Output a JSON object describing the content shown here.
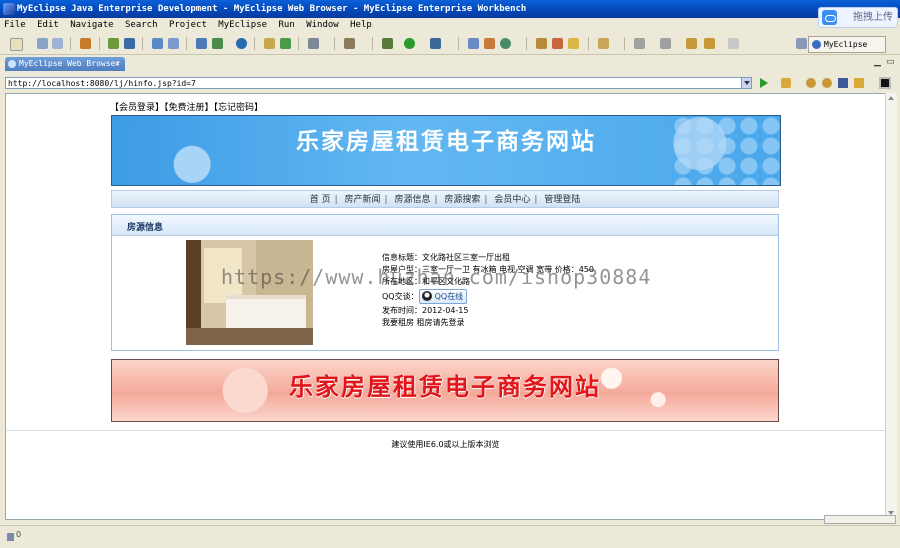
{
  "window": {
    "title": "MyEclipse Java Enterprise Development - MyEclipse Web Browser - MyEclipse Enterprise Workbench",
    "upload_label": "拖拽上传"
  },
  "menu": [
    "File",
    "Edit",
    "Navigate",
    "Search",
    "Project",
    "MyEclipse",
    "Run",
    "Window",
    "Help"
  ],
  "perspective": {
    "label": "MyEclipse ..."
  },
  "editor": {
    "tab_label": "MyEclipse Web Browser",
    "tab_close": "×",
    "address": "http://localhost:8080/lj/hinfo.jsp?id=7"
  },
  "page": {
    "top_links": [
      "【会员登录】",
      "【免费注册】",
      "【忘记密码】"
    ],
    "banner_title": "乐家房屋租赁电子商务网站",
    "nav": [
      "首 页",
      "房产新闻",
      "房源信息",
      "房源搜索",
      "会员中心",
      "管理登陆"
    ],
    "nav_separator": "|",
    "section_title": "房源信息",
    "info": {
      "title_row": "信息标题：文化路社区三室一厅出租",
      "type_row": "房屋户型：三室一厅一卫 有冰箱 电视 空调 宽带 价格：450",
      "area_row": "所在地区：和平区文化路",
      "qq_label": "QQ交谈：",
      "qq_button": "QQ在线",
      "date_row": "发布时间：2012-04-15",
      "rent_row": "我要租房 租房请先登录"
    },
    "watermark": "https://www.huzhan.com/ishop30884",
    "banner2_title": "乐家房屋租赁电子商务网站",
    "footer": "建议使用IE6.0或以上版本浏览"
  },
  "status": {
    "text": "0"
  },
  "colors": {
    "accent": "#0a5fd8",
    "banner_blue": "#3d9be5",
    "banner_red": "#e0161a"
  }
}
